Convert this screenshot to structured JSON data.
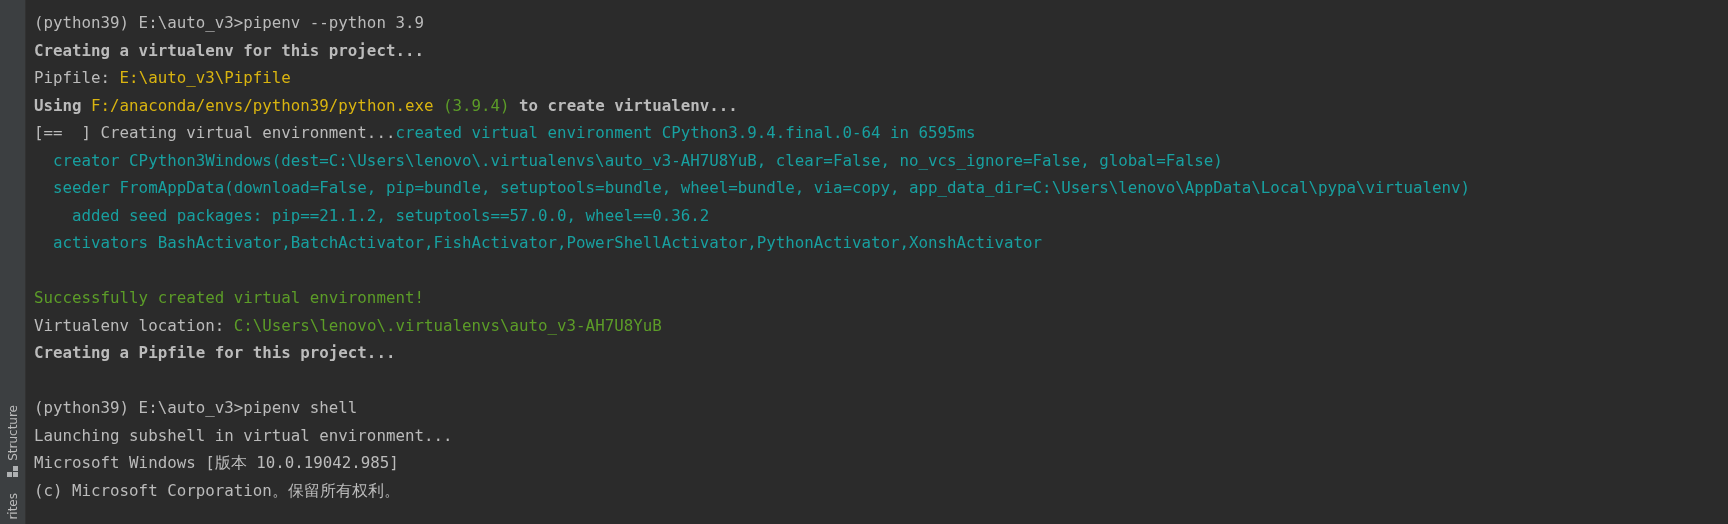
{
  "sidebar": {
    "tabs": [
      {
        "label": "Structure",
        "selected": false
      },
      {
        "label": "rites",
        "selected": false
      }
    ]
  },
  "terminal": {
    "lines": [
      {
        "kind": "text",
        "segments": [
          {
            "text": "(python39) E:\\auto_v3>pipenv --python 3.9",
            "kind": "output"
          }
        ]
      },
      {
        "kind": "text",
        "segments": [
          {
            "text": "Creating a virtualenv for this project...",
            "kind": "heading"
          }
        ]
      },
      {
        "kind": "text",
        "segments": [
          {
            "text": "Pipfile: ",
            "kind": "output"
          },
          {
            "text": "E:\\auto_v3\\Pipfile",
            "kind": "path"
          }
        ]
      },
      {
        "kind": "text",
        "segments": [
          {
            "text": "Using ",
            "kind": "heading"
          },
          {
            "text": "F:/anaconda/envs/python39/python.exe",
            "kind": "path"
          },
          {
            "text": " (3.9.4)",
            "kind": "success"
          },
          {
            "text": " to create virtualenv...",
            "kind": "heading"
          }
        ]
      },
      {
        "kind": "text",
        "segments": [
          {
            "text": "[==  ] Creating virtual environment...",
            "kind": "output"
          },
          {
            "text": "created virtual environment CPython3.9.4.final.0-64 in 6595ms",
            "kind": "info"
          }
        ]
      },
      {
        "kind": "text",
        "segments": [
          {
            "text": "  creator CPython3Windows(dest=C:\\Users\\lenovo\\.virtualenvs\\auto_v3-AH7U8YuB, clear=False, no_vcs_ignore=False, global=False)",
            "kind": "info"
          }
        ]
      },
      {
        "kind": "text",
        "segments": [
          {
            "text": "  seeder FromAppData(download=False, pip=bundle, setuptools=bundle, wheel=bundle, via=copy, app_data_dir=C:\\Users\\lenovo\\AppData\\Local\\pypa\\virtualenv)",
            "kind": "info"
          }
        ]
      },
      {
        "kind": "text",
        "segments": [
          {
            "text": "    added seed packages: pip==21.1.2, setuptools==57.0.0, wheel==0.36.2",
            "kind": "info"
          }
        ]
      },
      {
        "kind": "text",
        "segments": [
          {
            "text": "  activators BashActivator,BatchActivator,FishActivator,PowerShellActivator,PythonActivator,XonshActivator",
            "kind": "info"
          }
        ]
      },
      {
        "kind": "blank"
      },
      {
        "kind": "text",
        "segments": [
          {
            "text": "Successfully created virtual environment!",
            "kind": "success"
          }
        ]
      },
      {
        "kind": "text",
        "segments": [
          {
            "text": "Virtualenv location: ",
            "kind": "output"
          },
          {
            "text": "C:\\Users\\lenovo\\.virtualenvs\\auto_v3-AH7U8YuB",
            "kind": "success"
          }
        ]
      },
      {
        "kind": "text",
        "segments": [
          {
            "text": "Creating a Pipfile for this project...",
            "kind": "heading"
          }
        ]
      },
      {
        "kind": "blank"
      },
      {
        "kind": "text",
        "segments": [
          {
            "text": "(python39) E:\\auto_v3>pipenv shell",
            "kind": "output"
          }
        ]
      },
      {
        "kind": "text",
        "segments": [
          {
            "text": "Launching subshell in virtual environment...",
            "kind": "output"
          }
        ]
      },
      {
        "kind": "text",
        "segments": [
          {
            "text": "Microsoft Windows [版本 10.0.19042.985]",
            "kind": "output"
          }
        ]
      },
      {
        "kind": "text",
        "segments": [
          {
            "text": "(c) Microsoft Corporation。保留所有权利。",
            "kind": "output"
          }
        ]
      }
    ]
  }
}
